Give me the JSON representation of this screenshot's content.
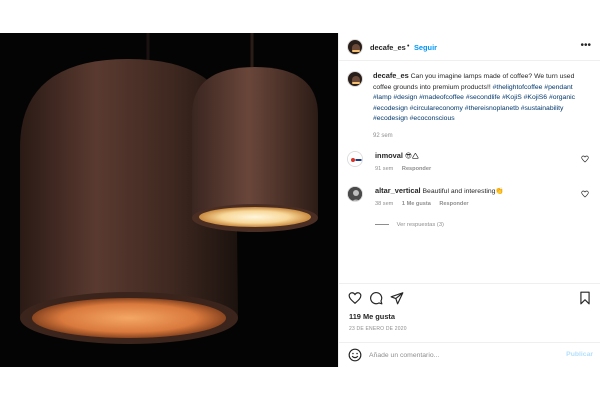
{
  "post": {
    "author": "decafe_es",
    "separator": "•",
    "follow_label": "Seguir",
    "more_label": "•••",
    "image_alt": "Two pendant lamps made of coffee grounds"
  },
  "caption": {
    "username": "decafe_es",
    "text": "Can you imagine lamps made of coffee? We turn used coffee grounds into premium products!!",
    "hashtags": "#thelightofcoffee #pendant #lamp #design #madeofcoffee #secondlife #KojiS #KojiS6 #organic #ecodesign #circulareconomy #thereisnoplanetb #sustainability #ecodesign #ecoconscious",
    "time": "92 sem"
  },
  "comments": [
    {
      "username": "inmoval",
      "text": "😎🛆",
      "time": "91 sem",
      "reply_label": "Responder",
      "likes_label": ""
    },
    {
      "username": "altar_vertical",
      "text": "Beautiful and interesting👏",
      "time": "38 sem",
      "likes_label": "1 Me gusta",
      "reply_label": "Responder"
    }
  ],
  "replies_label": "Ver respuestas (3)",
  "actions": {
    "likes": "119 Me gusta",
    "date": "23 DE ENERO DE 2020",
    "comment_placeholder": "Añade un comentario...",
    "publish_label": "Publicar"
  },
  "colors": {
    "link_blue": "#0095f6",
    "hashtag": "#00376b",
    "muted": "#8e8e8e",
    "publish_disabled": "#b2dffc"
  }
}
